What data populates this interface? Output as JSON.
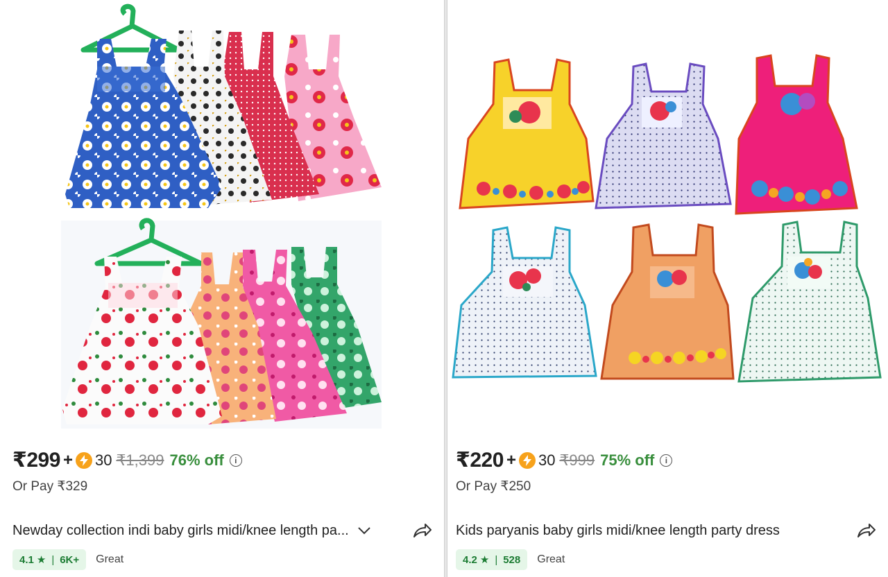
{
  "products": [
    {
      "price": "₹299",
      "plus": "+",
      "coins": "30",
      "mrp": "₹1,399",
      "discount": "76% off",
      "or_pay": "Or Pay ₹329",
      "title": "Newday collection indi baby girls midi/knee length pa...",
      "rating": "4.1",
      "reviews": "6K+",
      "quality": "Great",
      "icons": {
        "coin": "lightning-coin-icon",
        "info": "info-icon",
        "expand": "chevron-down-icon",
        "share": "share-icon",
        "star": "star-icon"
      }
    },
    {
      "price": "₹220",
      "plus": "+",
      "coins": "30",
      "mrp": "₹999",
      "discount": "75% off",
      "or_pay": "Or Pay ₹250",
      "title": "Kids paryanis baby girls midi/knee length party dress",
      "rating": "4.2",
      "reviews": "528",
      "quality": "Great",
      "icons": {
        "coin": "lightning-coin-icon",
        "info": "info-icon",
        "share": "share-icon",
        "star": "star-icon"
      }
    }
  ],
  "colors": {
    "discount_green": "#388e3c",
    "rating_bg": "#e5f6e8",
    "rating_text": "#1c7c33",
    "coin": "#f7a21b",
    "strike_grey": "#878787"
  }
}
